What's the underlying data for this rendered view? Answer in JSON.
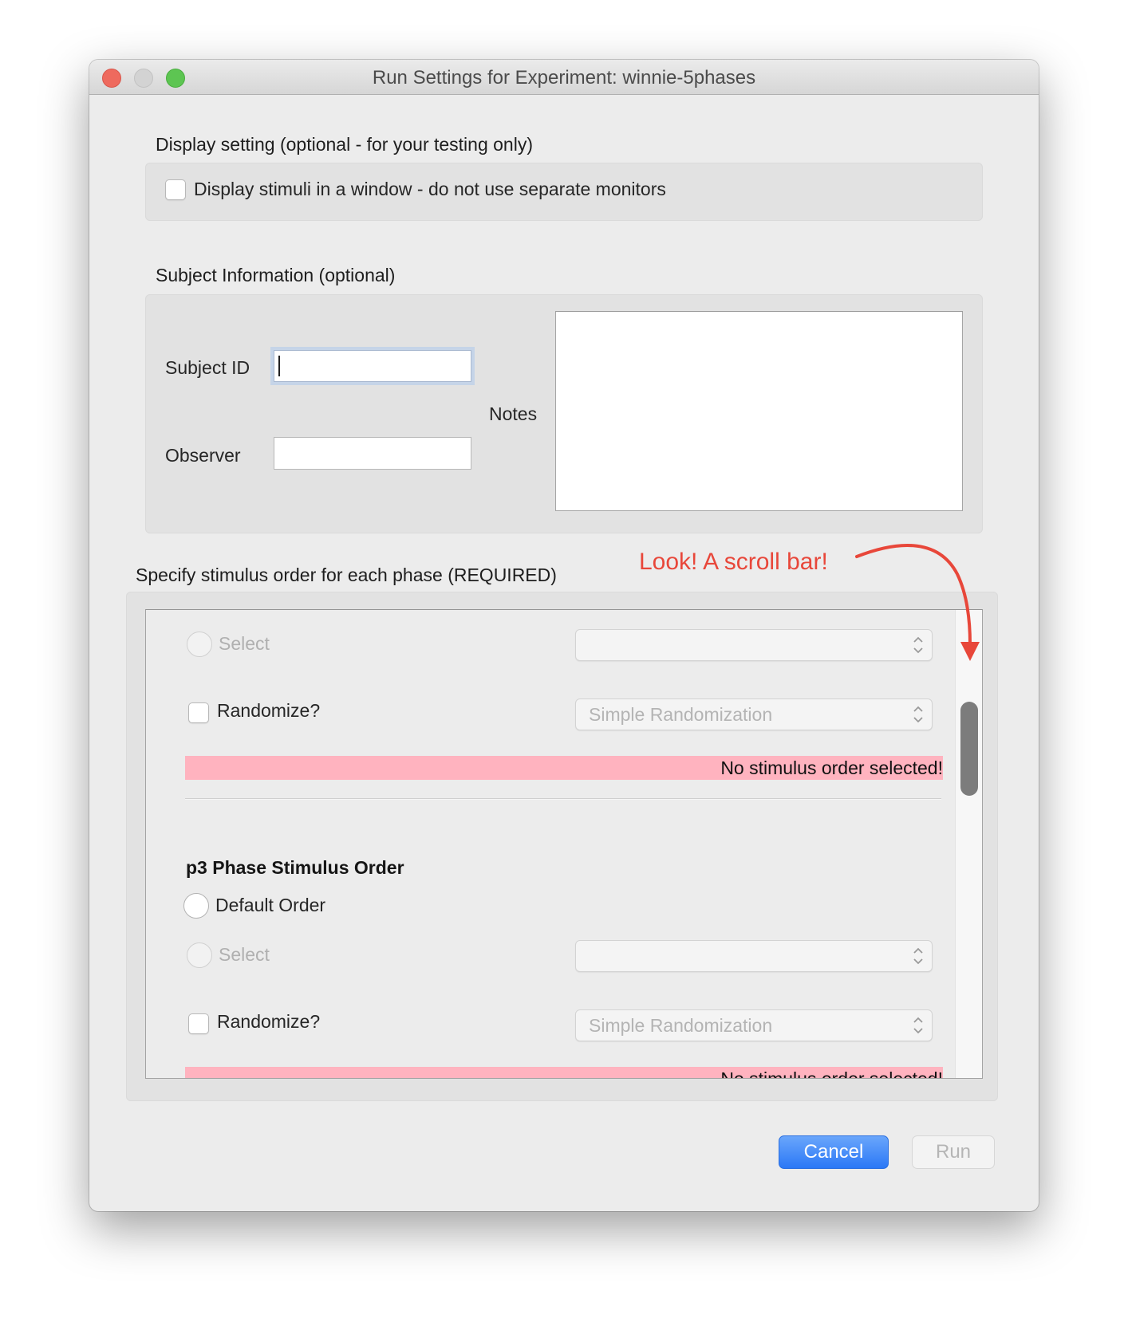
{
  "window": {
    "title": "Run Settings for Experiment: winnie-5phases",
    "controls": [
      "close",
      "minimize",
      "zoom"
    ]
  },
  "display_setting": {
    "heading": "Display setting (optional - for your testing only)",
    "checkbox_label": "Display stimuli in a window - do not use separate monitors",
    "checked": false
  },
  "subject_info": {
    "heading": "Subject Information (optional)",
    "subject_id_label": "Subject ID",
    "subject_id_value": "",
    "observer_label": "Observer",
    "observer_value": "",
    "notes_label": "Notes",
    "notes_value": ""
  },
  "stimulus_order": {
    "heading": "Specify stimulus order for each phase (REQUIRED)",
    "phases": [
      {
        "heading": "",
        "default_order_label": "",
        "select_label": "Select",
        "select_value": "",
        "randomize_label": "Randomize?",
        "randomize_checked": false,
        "randomization_value": "Simple Randomization",
        "error": "No stimulus order selected!"
      },
      {
        "heading": "p3 Phase Stimulus Order",
        "default_order_label": "Default Order",
        "select_label": "Select",
        "select_value": "",
        "randomize_label": "Randomize?",
        "randomize_checked": false,
        "randomization_value": "Simple Randomization",
        "error": "No stimulus order selected!"
      }
    ],
    "scroll_position_fraction": 0.22
  },
  "buttons": {
    "cancel": "Cancel",
    "run": "Run"
  },
  "annotation": {
    "text": "Look! A scroll bar!",
    "color": "#e8473a"
  },
  "colors": {
    "accent": "#2b78f6",
    "error_bg": "#ffb3bf"
  }
}
